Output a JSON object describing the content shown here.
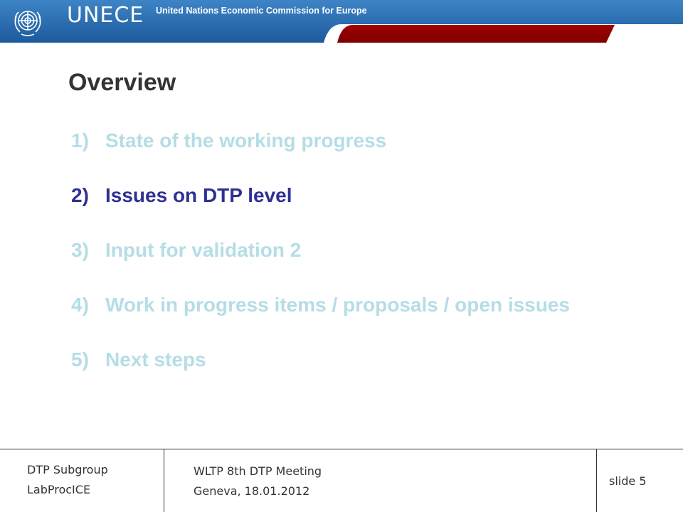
{
  "header": {
    "brand": "UNECE",
    "brand_full": "United Nations Economic Commission for Europe",
    "logo_icon": "un-emblem-icon",
    "colors": {
      "blue": "#2a6fb5",
      "red": "#9b0000"
    }
  },
  "slide": {
    "title": "Overview",
    "items": [
      {
        "num": "1)",
        "text": "State of the working progress",
        "active": false
      },
      {
        "num": "2)",
        "text": "Issues on DTP level",
        "active": true
      },
      {
        "num": "3)",
        "text": "Input for validation 2",
        "active": false
      },
      {
        "num": "4)",
        "text": "Work in progress items / proposals / open issues",
        "active": false
      },
      {
        "num": "5)",
        "text": "Next steps",
        "active": false
      }
    ],
    "colors": {
      "active": "#2e3192",
      "inactive": "#b5dde6",
      "title": "#333333"
    }
  },
  "footer": {
    "left_line1": "DTP Subgroup",
    "left_line2": "LabProcICE",
    "center_line1": "WLTP 8th DTP Meeting",
    "center_line2": "Geneva, 18.01.2012",
    "right": "slide 5"
  }
}
